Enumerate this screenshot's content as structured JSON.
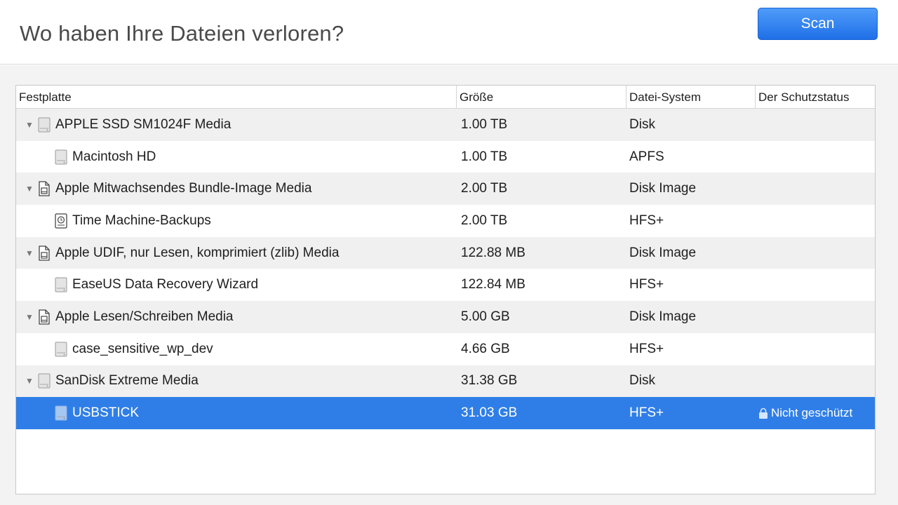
{
  "header": {
    "title": "Wo haben Ihre Dateien verloren?",
    "scan_label": "Scan"
  },
  "table": {
    "columns": [
      "Festplatte",
      "Größe",
      "Datei-System",
      "Der Schutzstatus"
    ],
    "rows": [
      {
        "name": "APPLE SSD SM1024F Media",
        "size": "1.00 TB",
        "fs": "Disk",
        "protection": "",
        "level": 0,
        "expanded": true,
        "icon": "hard-disk-icon"
      },
      {
        "name": "Macintosh HD",
        "size": "1.00 TB",
        "fs": "APFS",
        "protection": "",
        "level": 1,
        "icon": "hard-disk-icon"
      },
      {
        "name": "Apple Mitwachsendes Bundle-Image Media",
        "size": "2.00 TB",
        "fs": "Disk Image",
        "protection": "",
        "level": 0,
        "expanded": true,
        "icon": "disk-image-icon"
      },
      {
        "name": "Time Machine-Backups",
        "size": "2.00 TB",
        "fs": "HFS+",
        "protection": "",
        "level": 1,
        "icon": "time-machine-icon"
      },
      {
        "name": "Apple UDIF, nur Lesen, komprimiert (zlib) Media",
        "size": "122.88 MB",
        "fs": "Disk Image",
        "protection": "",
        "level": 0,
        "expanded": true,
        "icon": "disk-image-icon"
      },
      {
        "name": "EaseUS Data Recovery Wizard",
        "size": "122.84 MB",
        "fs": "HFS+",
        "protection": "",
        "level": 1,
        "icon": "hard-disk-icon"
      },
      {
        "name": "Apple Lesen/Schreiben Media",
        "size": "5.00 GB",
        "fs": "Disk Image",
        "protection": "",
        "level": 0,
        "expanded": true,
        "icon": "disk-image-icon"
      },
      {
        "name": "case_sensitive_wp_dev",
        "size": "4.66 GB",
        "fs": "HFS+",
        "protection": "",
        "level": 1,
        "icon": "hard-disk-icon"
      },
      {
        "name": "SanDisk Extreme Media",
        "size": "31.38 GB",
        "fs": "Disk",
        "protection": "",
        "level": 0,
        "expanded": true,
        "icon": "hard-disk-icon"
      },
      {
        "name": "USBSTICK",
        "size": "31.03 GB",
        "fs": "HFS+",
        "protection": "Nicht geschützt",
        "level": 1,
        "icon": "hard-disk-icon",
        "selected": true,
        "protection_icon": "lock-icon"
      }
    ]
  },
  "colors": {
    "accent": "#2f7ee8",
    "button": "#1f6fe8",
    "row_alt": "#f0f0f0"
  }
}
